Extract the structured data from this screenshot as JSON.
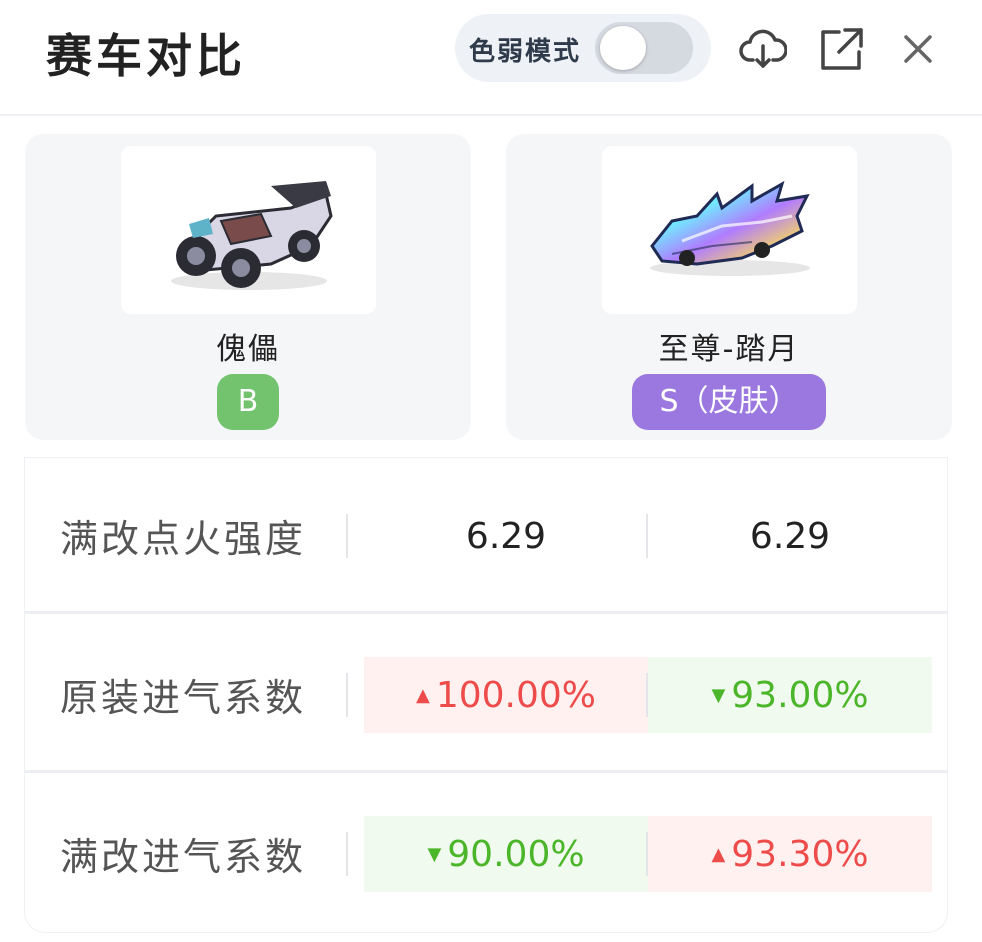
{
  "header": {
    "title": "赛车对比",
    "colorblind_label": "色弱模式",
    "colorblind_enabled": false
  },
  "cars": [
    {
      "name": "傀儡",
      "grade": "B",
      "grade_color": "#72c26e"
    },
    {
      "name": "至尊-踏月",
      "grade": "S（皮肤）",
      "grade_color": "#9b78df"
    }
  ],
  "stats": [
    {
      "label": "满改点火强度",
      "values": [
        {
          "text": "6.29",
          "trend": "none"
        },
        {
          "text": "6.29",
          "trend": "none"
        }
      ]
    },
    {
      "label": "原装进气系数",
      "values": [
        {
          "text": "100.00%",
          "trend": "up",
          "arrow": "▲"
        },
        {
          "text": "93.00%",
          "trend": "down",
          "arrow": "▼"
        }
      ]
    },
    {
      "label": "满改进气系数",
      "values": [
        {
          "text": "90.00%",
          "trend": "down",
          "arrow": "▼"
        },
        {
          "text": "93.30%",
          "trend": "up",
          "arrow": "▲"
        }
      ]
    }
  ],
  "colors": {
    "up": "#ee4b4b",
    "down": "#4bb62a"
  }
}
